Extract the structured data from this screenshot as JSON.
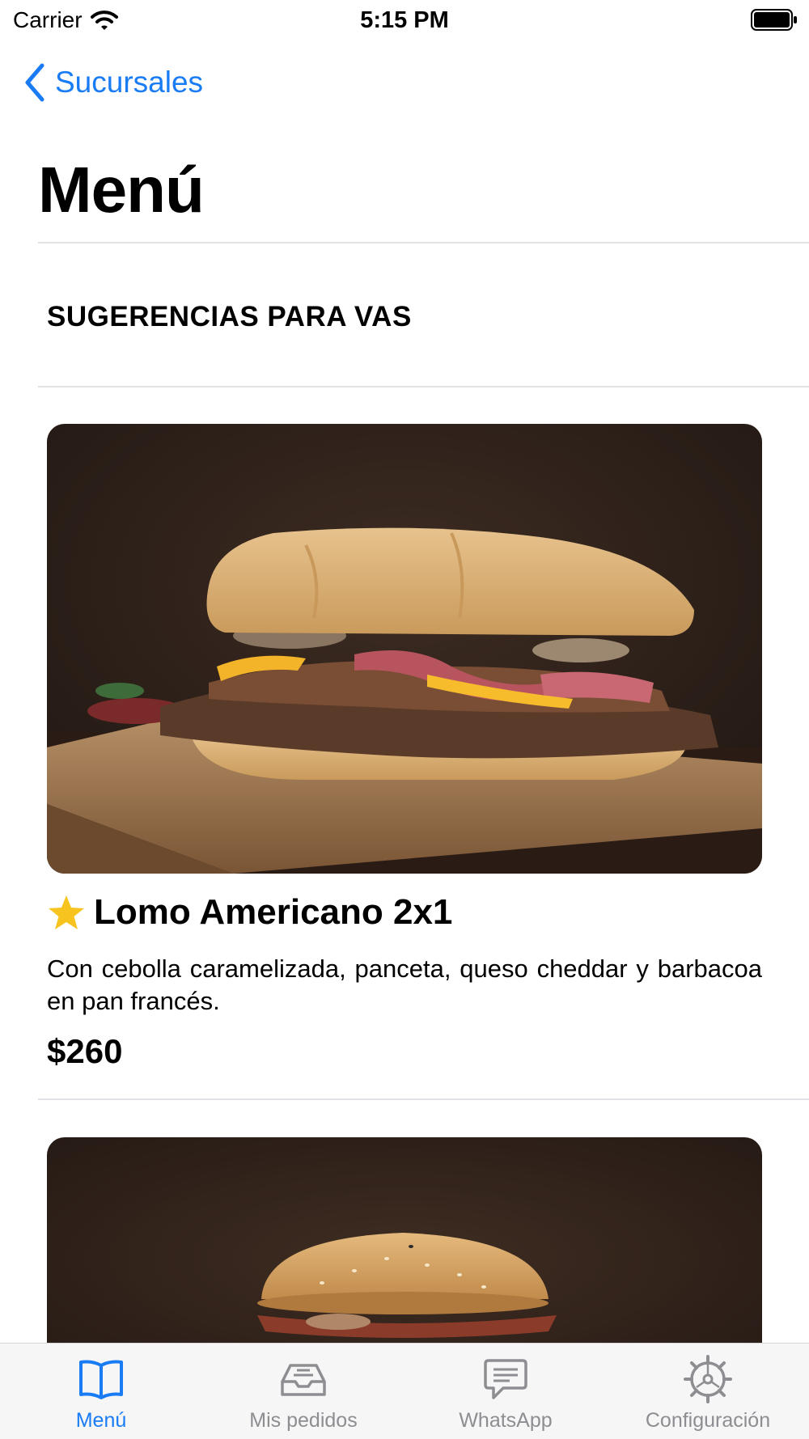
{
  "status_bar": {
    "carrier": "Carrier",
    "time": "5:15 PM",
    "icons": [
      "wifi-icon",
      "battery-icon"
    ]
  },
  "nav": {
    "back_label": "Sucursales",
    "back_icon": "chevron-left-icon",
    "accent_color": "#1a7cf5"
  },
  "page": {
    "title": "Menú"
  },
  "section": {
    "title": "SUGERENCIAS PARA VAS"
  },
  "items": [
    {
      "name": "Lomo Americano 2x1",
      "badge_icon": "star-icon",
      "description": "Con cebolla caramelizada, panceta, queso cheddar y barbacoa en pan francés.",
      "price": "$260",
      "image": "sandwich-photo"
    },
    {
      "image": "burger-photo"
    }
  ],
  "tab_bar": {
    "tabs": [
      {
        "label": "Menú",
        "icon": "book-icon",
        "active": true
      },
      {
        "label": "Mis pedidos",
        "icon": "tray-icon",
        "active": false
      },
      {
        "label": "WhatsApp",
        "icon": "message-icon",
        "active": false
      },
      {
        "label": "Configuración",
        "icon": "gear-icon",
        "active": false
      }
    ],
    "active_color": "#1a7cf5",
    "inactive_color": "#8d8d92"
  }
}
